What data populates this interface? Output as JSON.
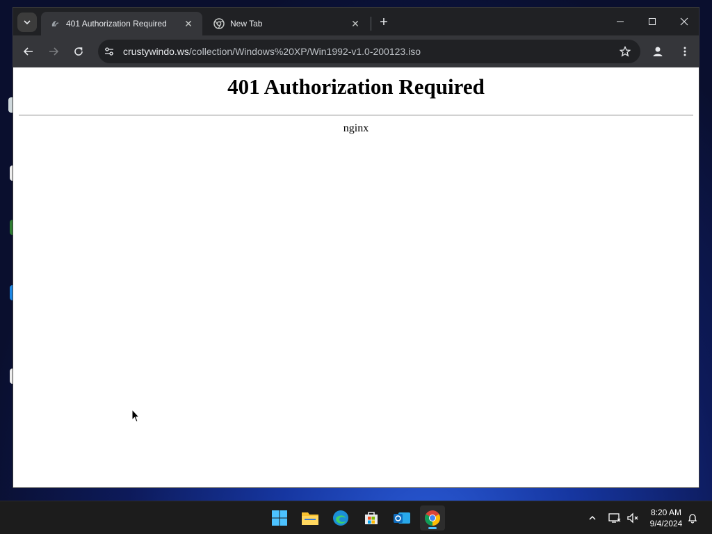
{
  "browser": {
    "tabs": [
      {
        "title": "401 Authorization Required",
        "active": true,
        "favicon": "site-favicon-icon"
      },
      {
        "title": "New Tab",
        "active": false,
        "favicon": "chrome-icon"
      }
    ],
    "url": {
      "host": "crustywindo.ws",
      "path": "/collection/Windows%20XP/Win1992-v1.0-200123.iso"
    }
  },
  "page": {
    "heading": "401 Authorization Required",
    "server": "nginx"
  },
  "taskbar": {
    "apps": [
      "start-icon",
      "file-explorer-icon",
      "edge-icon",
      "store-icon",
      "outlook-icon",
      "chrome-icon"
    ],
    "active_app": "chrome-icon",
    "time": "8:20 AM",
    "date": "9/4/2024"
  },
  "colors": {
    "accent": "#4cc2ff",
    "toolbar": "#35363a",
    "tabstrip": "#202124"
  }
}
